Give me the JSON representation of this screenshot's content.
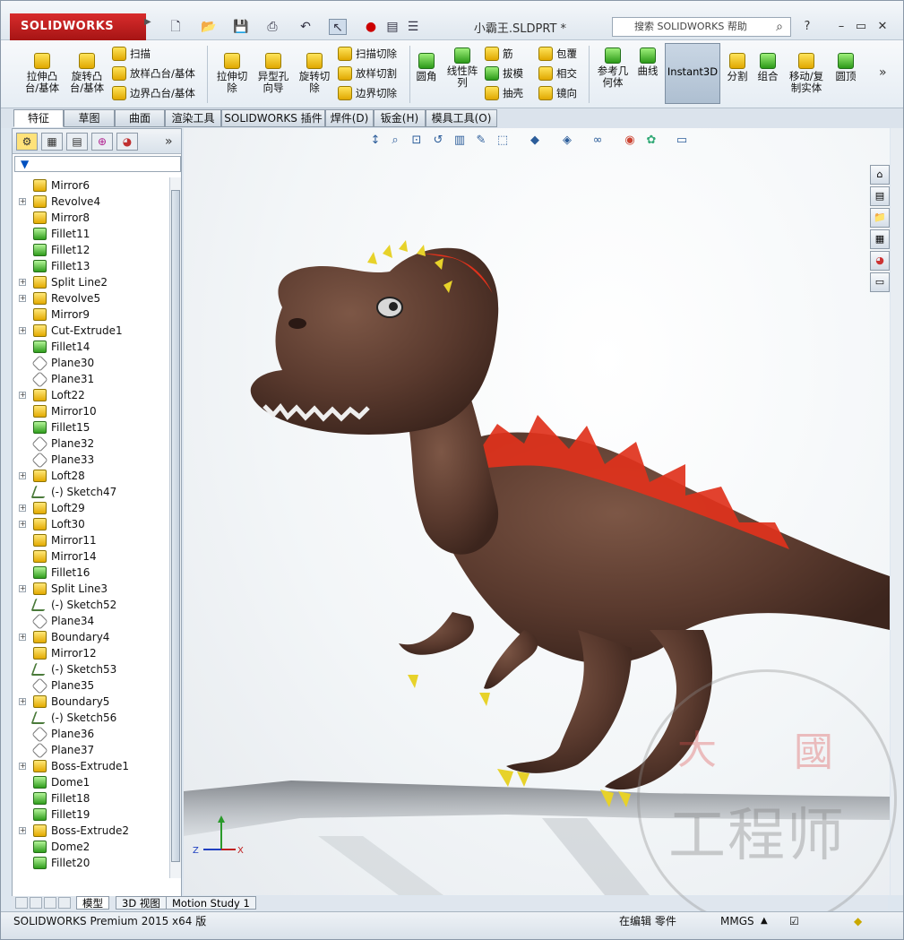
{
  "window": {
    "brand": "SOLIDWORKS",
    "filename": "小霸王.SLDPRT *",
    "help_search_placeholder": "搜索 SOLIDWORKS 帮助"
  },
  "ribbon": {
    "extrude_boss": "拉伸凸\n台/基体",
    "revolve_boss": "旋转凸\n台/基体",
    "sweep": "扫描",
    "loft": "放样凸台/基体",
    "boundary_boss": "边界凸台/基体",
    "extrude_cut": "拉伸切\n除",
    "hole_wizard": "异型孔\n向导",
    "revolve_cut": "旋转切\n除",
    "sweep_cut": "扫描切除",
    "loft_cut": "放样切割",
    "boundary_cut": "边界切除",
    "fillet": "圆角",
    "linear_pattern": "线性阵\n列",
    "rib": "筋",
    "draft": "拔模",
    "shell": "抽壳",
    "wrap": "包覆",
    "intersect": "相交",
    "mirror": "镜向",
    "ref_geometry": "参考几\n何体",
    "curves": "曲线",
    "instant3d": "Instant3D",
    "split": "分割",
    "combine": "组合",
    "move_copy": "移动/复\n制实体",
    "dome": "圆顶"
  },
  "command_tabs": [
    "特征",
    "草图",
    "曲面",
    "渲染工具",
    "SOLIDWORKS 插件",
    "焊件(D)",
    "钣金(H)",
    "模具工具(O)"
  ],
  "tree": [
    {
      "label": "Mirror6",
      "icon": "mirror",
      "exp": false
    },
    {
      "label": "Revolve4",
      "icon": "revolve",
      "exp": true
    },
    {
      "label": "Mirror8",
      "icon": "mirror",
      "exp": false
    },
    {
      "label": "Fillet11",
      "icon": "fillet",
      "exp": false
    },
    {
      "label": "Fillet12",
      "icon": "fillet",
      "exp": false
    },
    {
      "label": "Fillet13",
      "icon": "fillet",
      "exp": false
    },
    {
      "label": "Split Line2",
      "icon": "split",
      "exp": true
    },
    {
      "label": "Revolve5",
      "icon": "revolve",
      "exp": true
    },
    {
      "label": "Mirror9",
      "icon": "mirror",
      "exp": false
    },
    {
      "label": "Cut-Extrude1",
      "icon": "cut",
      "exp": true
    },
    {
      "label": "Fillet14",
      "icon": "fillet",
      "exp": false
    },
    {
      "label": "Plane30",
      "icon": "plane",
      "exp": false
    },
    {
      "label": "Plane31",
      "icon": "plane",
      "exp": false
    },
    {
      "label": "Loft22",
      "icon": "loft",
      "exp": true
    },
    {
      "label": "Mirror10",
      "icon": "mirror",
      "exp": false
    },
    {
      "label": "Fillet15",
      "icon": "fillet",
      "exp": false
    },
    {
      "label": "Plane32",
      "icon": "plane",
      "exp": false
    },
    {
      "label": "Plane33",
      "icon": "plane",
      "exp": false
    },
    {
      "label": "Loft28",
      "icon": "loft",
      "exp": true
    },
    {
      "label": "(-) Sketch47",
      "icon": "sketch",
      "exp": false
    },
    {
      "label": "Loft29",
      "icon": "loft",
      "exp": true
    },
    {
      "label": "Loft30",
      "icon": "loft",
      "exp": true
    },
    {
      "label": "Mirror11",
      "icon": "mirror",
      "exp": false
    },
    {
      "label": "Mirror14",
      "icon": "mirror",
      "exp": false
    },
    {
      "label": "Fillet16",
      "icon": "fillet",
      "exp": false
    },
    {
      "label": "Split Line3",
      "icon": "split",
      "exp": true
    },
    {
      "label": "(-) Sketch52",
      "icon": "sketch",
      "exp": false
    },
    {
      "label": "Plane34",
      "icon": "plane",
      "exp": false
    },
    {
      "label": "Boundary4",
      "icon": "boundary",
      "exp": true
    },
    {
      "label": "Mirror12",
      "icon": "mirror",
      "exp": false
    },
    {
      "label": "(-) Sketch53",
      "icon": "sketch",
      "exp": false
    },
    {
      "label": "Plane35",
      "icon": "plane",
      "exp": false
    },
    {
      "label": "Boundary5",
      "icon": "boundary",
      "exp": true
    },
    {
      "label": "(-) Sketch56",
      "icon": "sketch",
      "exp": false
    },
    {
      "label": "Plane36",
      "icon": "plane",
      "exp": false
    },
    {
      "label": "Plane37",
      "icon": "plane",
      "exp": false
    },
    {
      "label": "Boss-Extrude1",
      "icon": "extrude",
      "exp": true
    },
    {
      "label": "Dome1",
      "icon": "dome",
      "exp": false
    },
    {
      "label": "Fillet18",
      "icon": "fillet",
      "exp": false
    },
    {
      "label": "Fillet19",
      "icon": "fillet",
      "exp": false
    },
    {
      "label": "Boss-Extrude2",
      "icon": "extrude",
      "exp": true
    },
    {
      "label": "Dome2",
      "icon": "dome",
      "exp": false
    },
    {
      "label": "Fillet20",
      "icon": "fillet",
      "exp": false
    }
  ],
  "bottom_tabs": [
    "模型",
    "3D 视图",
    "Motion Study 1"
  ],
  "status": {
    "product": "SOLIDWORKS Premium 2015 x64 版",
    "mode": "在编辑 零件",
    "units": "MMGS"
  },
  "watermark": {
    "top_left": "大",
    "top_right": "國",
    "bottom": "工程师"
  },
  "triad": {
    "z": "Z",
    "x": "X"
  }
}
